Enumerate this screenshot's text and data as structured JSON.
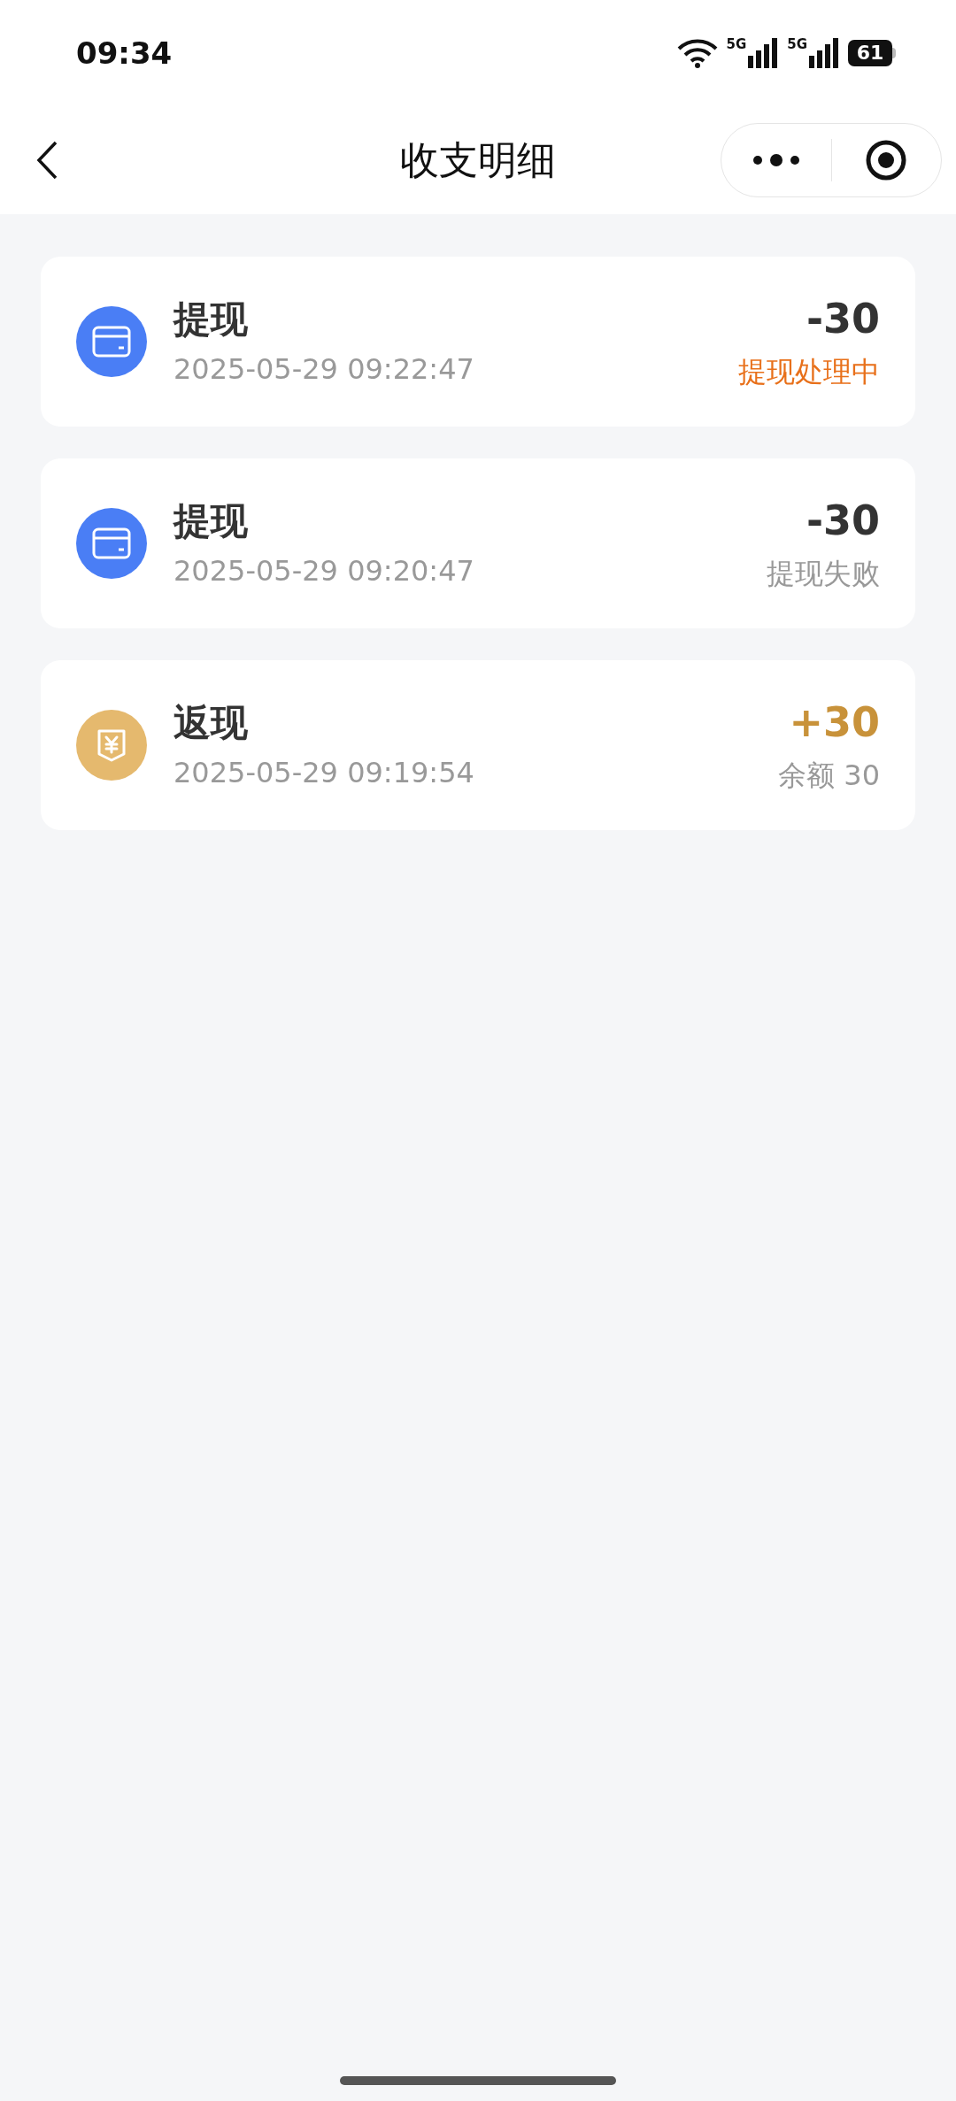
{
  "status_bar": {
    "time": "09:34",
    "signal_labels": [
      "5G",
      "5G"
    ],
    "battery": "61"
  },
  "nav": {
    "title": "收支明细"
  },
  "records": [
    {
      "kind": "withdraw",
      "title": "提现",
      "time": "2025-05-29 09:22:47",
      "amount": "-30",
      "status": {
        "text": "提现处理中",
        "color": "#e8701a"
      }
    },
    {
      "kind": "withdraw",
      "title": "提现",
      "time": "2025-05-29 09:20:47",
      "amount": "-30",
      "status": {
        "text": "提现失败",
        "color": "#999999"
      }
    },
    {
      "kind": "cashback",
      "title": "返现",
      "time": "2025-05-29 09:19:54",
      "amount": "+30",
      "status": {
        "text": "余额 30",
        "color": "#999999"
      }
    }
  ]
}
